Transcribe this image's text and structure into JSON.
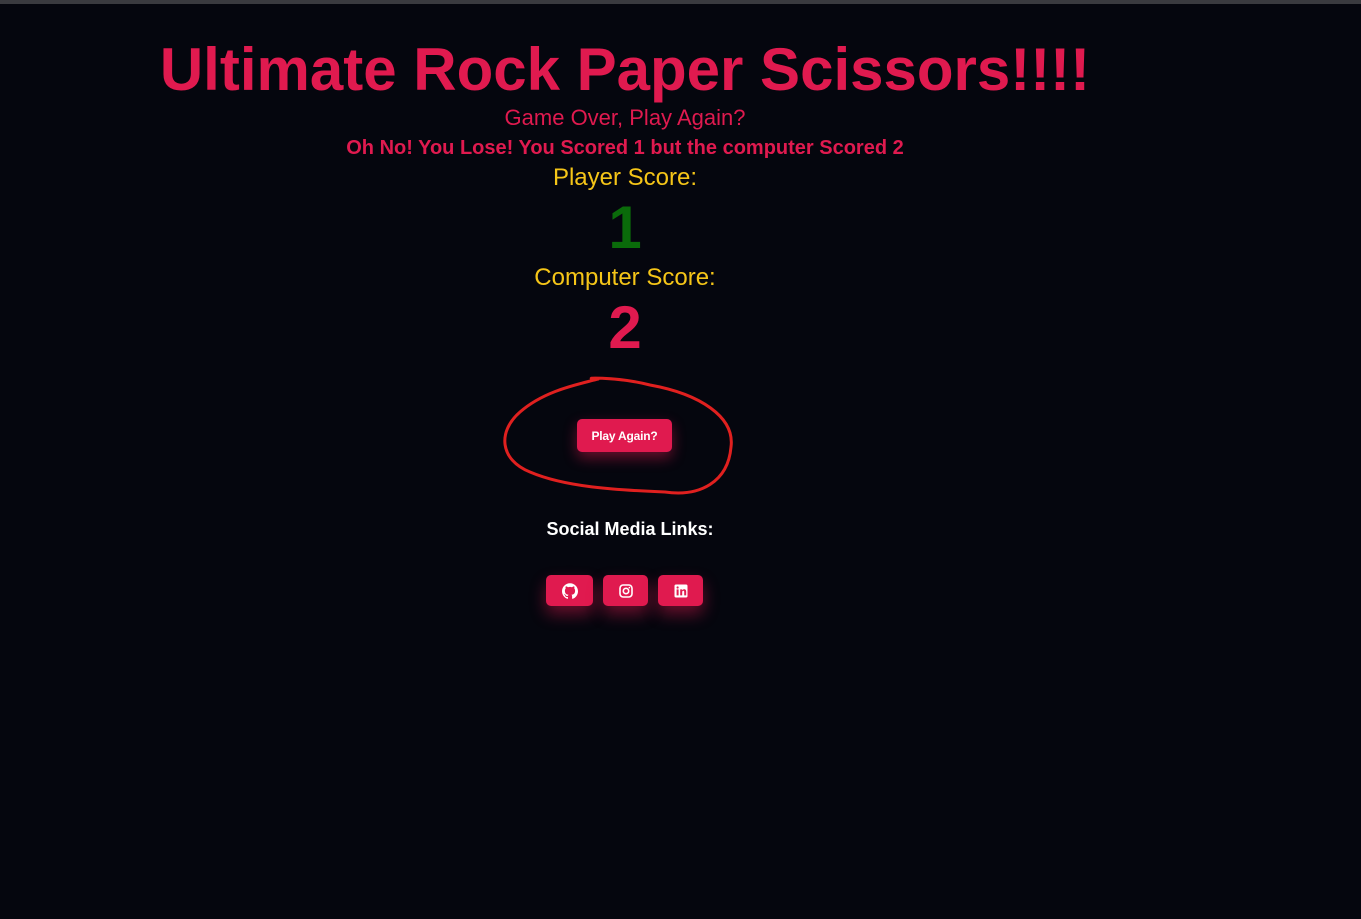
{
  "game": {
    "title": "Ultimate Rock Paper Scissors!!!!",
    "status": "Game Over, Play Again?",
    "result_message": "Oh No! You Lose! You Scored 1 but the computer Scored 2",
    "player_label": "Player Score:",
    "player_score": "1",
    "computer_label": "Computer Score:",
    "computer_score": "2",
    "play_again_label": "Play Again?"
  },
  "social": {
    "heading": "Social Media Links:",
    "links": [
      {
        "icon": "github-icon"
      },
      {
        "icon": "instagram-icon"
      },
      {
        "icon": "linkedin-icon"
      }
    ]
  },
  "colors": {
    "background": "#05060e",
    "accent": "#e01a4f",
    "label": "#f5c518",
    "player_score": "#0a6b0a",
    "annotation": "#e0201f"
  }
}
